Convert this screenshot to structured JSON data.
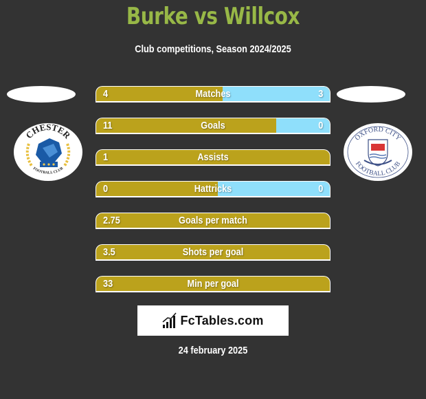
{
  "header": {
    "title": "Burke vs Willcox",
    "subtitle": "Club competitions, Season 2024/2025"
  },
  "teams": {
    "left": {
      "name": "Chester Football Club",
      "logo_icon": "chester-fc-crest-icon",
      "logo_text_top": "CHESTER",
      "logo_text_bottom": "FOOTBALL CLUB"
    },
    "right": {
      "name": "Oxford City Football Club",
      "logo_icon": "oxford-city-fc-crest-icon",
      "logo_text_top": "OXFORD CITY",
      "logo_text_bottom": "FOOTBALL CLUB"
    }
  },
  "colors": {
    "left_player": "#bba21c",
    "right_player": "#8fdffb",
    "title": "#98b847",
    "background": "#333333"
  },
  "stats": [
    {
      "label": "Matches",
      "left": "4",
      "right": "3",
      "left_share": 0.54
    },
    {
      "label": "Goals",
      "left": "11",
      "right": "0",
      "left_share": 0.77
    },
    {
      "label": "Assists",
      "left": "1",
      "right": "",
      "left_share": 1.0
    },
    {
      "label": "Hattricks",
      "left": "0",
      "right": "0",
      "left_share": 0.52
    },
    {
      "label": "Goals per match",
      "left": "2.75",
      "right": "",
      "left_share": 1.0
    },
    {
      "label": "Shots per goal",
      "left": "3.5",
      "right": "",
      "left_share": 1.0
    },
    {
      "label": "Min per goal",
      "left": "33",
      "right": "",
      "left_share": 1.0
    }
  ],
  "footer": {
    "brand": "FcTables.com",
    "brand_icon": "bar-chart-icon",
    "date": "24 february 2025"
  }
}
